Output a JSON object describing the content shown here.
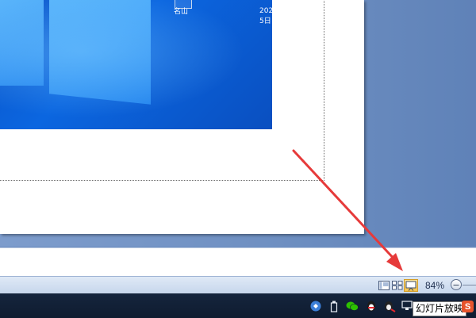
{
  "desktop_preview": {
    "icon_label": "名山",
    "side_text_line1": "202",
    "side_text_line2": "5日"
  },
  "status_bar": {
    "view_buttons": [
      {
        "name": "normal-view-button",
        "icon": "normal-view-icon",
        "active": false
      },
      {
        "name": "slide-sorter-button",
        "icon": "slide-sorter-icon",
        "active": false
      },
      {
        "name": "slide-show-button",
        "icon": "slide-show-icon",
        "active": true
      }
    ],
    "zoom_level": "84%",
    "zoom_out_symbol": "−"
  },
  "taskbar": {
    "tray_icons": [
      "security-shield-icon",
      "usb-device-icon",
      "wechat-icon",
      "qq-penguin-icon",
      "qq-penguin-alt-icon",
      "network-icon"
    ],
    "tooltip_text": "幻灯片放映",
    "app_badge": "S"
  },
  "colors": {
    "annotation_arrow": "#e63a3a",
    "active_view_button": "#f5c24a",
    "workspace_bg": "#6e8fc1"
  }
}
